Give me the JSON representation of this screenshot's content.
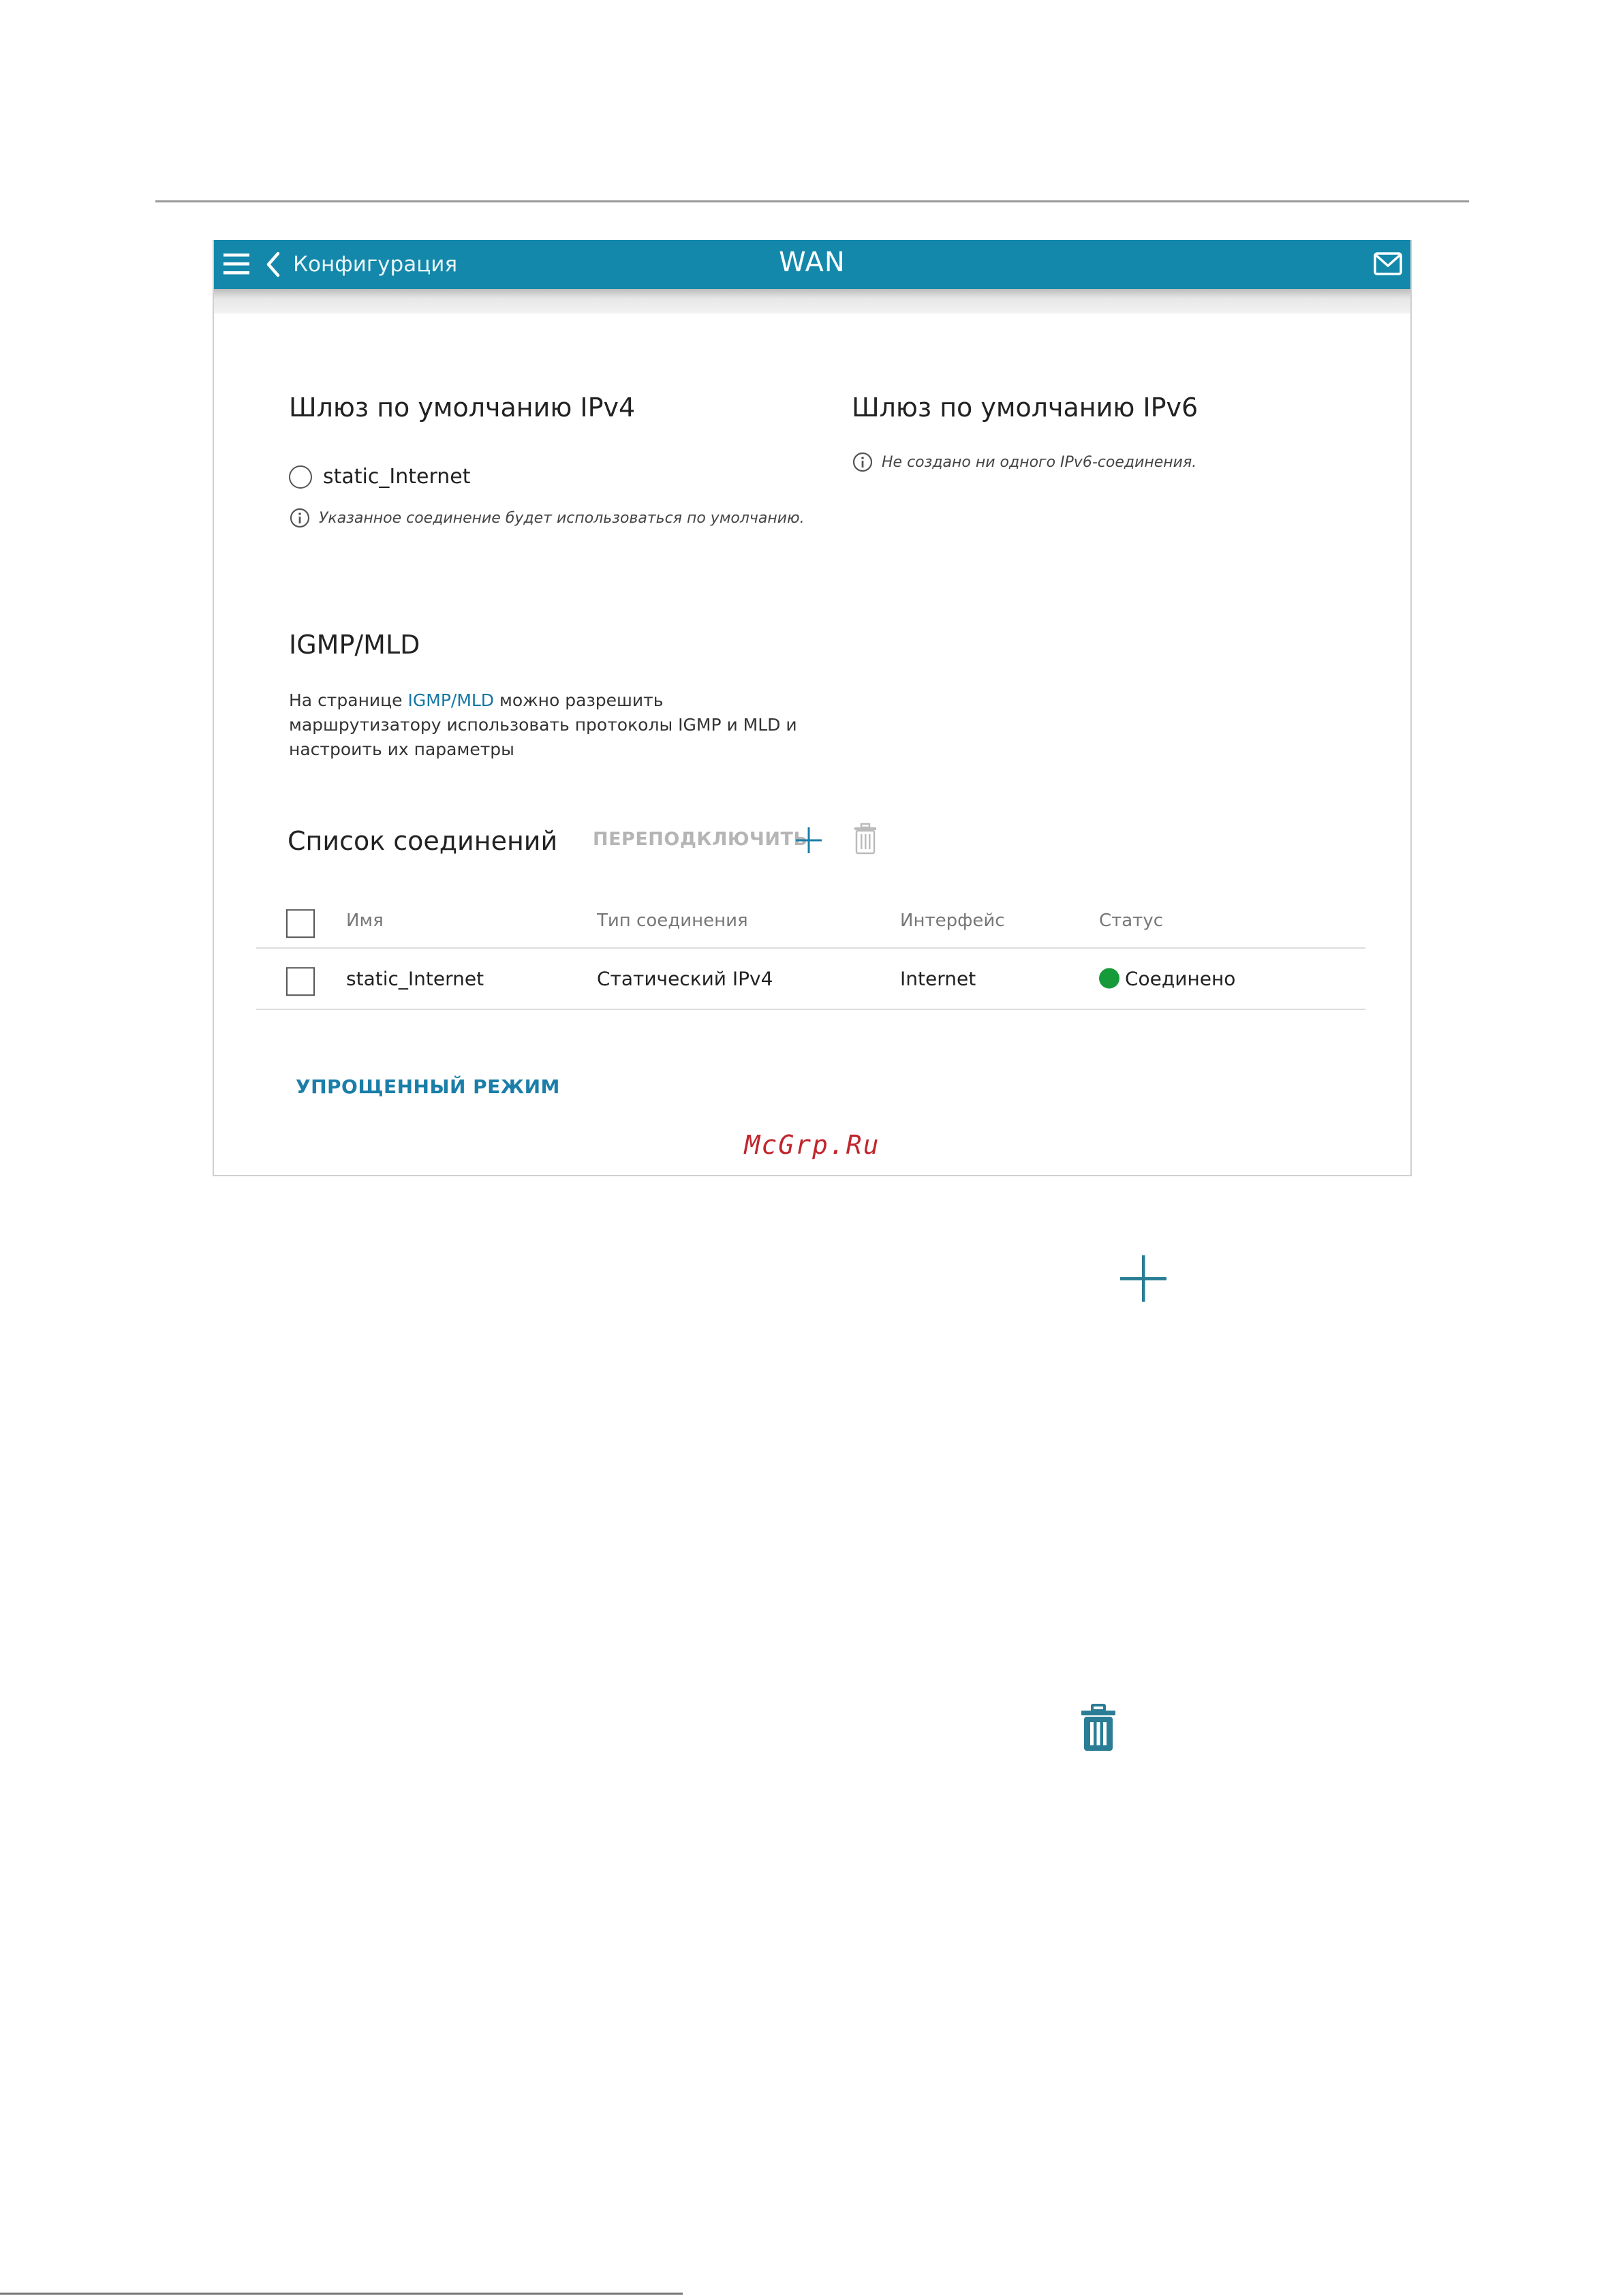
{
  "header": {
    "back_label": "Конфигурация",
    "title": "WAN",
    "accent_color": "#1488ab"
  },
  "ipv4_gateway": {
    "title": "Шлюз по умолчанию IPv4",
    "option_label": "static_Internet",
    "note": "Указанное соединение будет использоваться по умолчанию."
  },
  "ipv6_gateway": {
    "title": "Шлюз по умолчанию IPv6",
    "note": "Не создано ни одного IPv6-соединения."
  },
  "igmp": {
    "title": "IGMP/MLD",
    "text_before": "На странице ",
    "link": "IGMP/MLD",
    "text_after": " можно разрешить маршрутизатору использовать протоколы IGMP и MLD и настроить их параметры"
  },
  "connections": {
    "title": "Список соединений",
    "reconnect_label": "ПЕРЕПОДКЛЮЧИТЬ",
    "columns": [
      "Имя",
      "Тип соединения",
      "Интерфейс",
      "Статус"
    ],
    "rows": [
      {
        "name": "static_Internet",
        "type": "Статический IPv4",
        "interface": "Internet",
        "status": "Соединено",
        "status_color": "#179b3a"
      }
    ]
  },
  "footer": {
    "simple_mode_label": "УПРОЩЕННЫЙ РЕЖИМ",
    "watermark": "McGrp.Ru"
  },
  "icons": [
    "menu-icon",
    "chevron-left-icon",
    "mail-icon",
    "info-icon",
    "plus-icon",
    "trash-icon"
  ]
}
